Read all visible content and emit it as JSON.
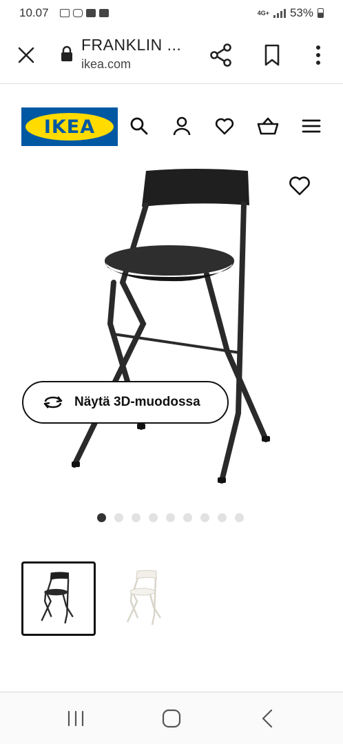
{
  "status_bar": {
    "time": "10.07",
    "network": "4G+",
    "battery": "53%",
    "icons": [
      "email-icon",
      "instagram-icon",
      "mail-icon",
      "check-icon"
    ]
  },
  "browser": {
    "page_title": "FRANKLIN ...",
    "domain": "ikea.com",
    "icons": [
      "close-icon",
      "lock-icon",
      "share-icon",
      "bookmark-icon",
      "more-icon"
    ]
  },
  "site_header": {
    "logo_text": "IKEA",
    "logo_colors": {
      "blue": "#0058a3",
      "yellow": "#ffdb00"
    },
    "icons": [
      "search-icon",
      "account-icon",
      "favorites-icon",
      "cart-icon",
      "menu-icon"
    ]
  },
  "product": {
    "view_3d_label": "Näytä 3D-muodossa",
    "icons": [
      "favorite-icon",
      "rotate-3d-icon"
    ],
    "carousel": {
      "count": 9,
      "active_index": 0
    },
    "thumbnails": [
      {
        "color": "black",
        "selected": true
      },
      {
        "color": "white",
        "selected": false
      }
    ]
  },
  "nav_bar": {
    "icons": [
      "recents-icon",
      "home-icon",
      "back-icon"
    ]
  }
}
